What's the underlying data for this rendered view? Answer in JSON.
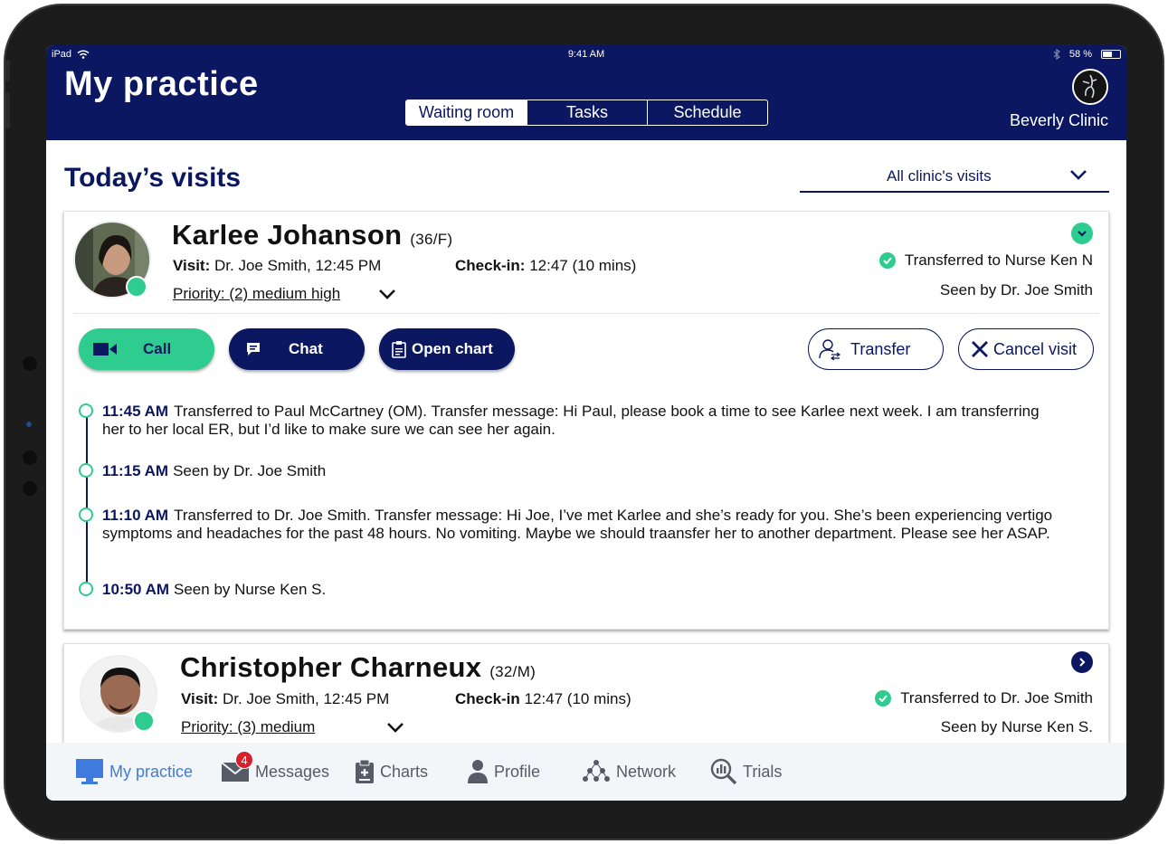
{
  "status_bar": {
    "device": "iPad",
    "time": "9:41 AM",
    "battery": "58 %"
  },
  "header": {
    "title": "My practice",
    "tabs": [
      "Waiting room",
      "Tasks",
      "Schedule"
    ],
    "clinic": "Beverly Clinic"
  },
  "main": {
    "title": "Today’s visits",
    "filter": "All clinic's visits"
  },
  "visits": [
    {
      "name": "Karlee Johanson",
      "age_sex": "(36/F)",
      "visit_label": "Visit:",
      "visit_value": "Dr. Joe Smith, 12:45 PM",
      "checkin_label": "Check-in:",
      "checkin_value": "12:47 (10 mins)",
      "priority": "Priority: (2) medium high",
      "status": "Transferred to Nurse Ken N",
      "seen": "Seen by Dr. Joe Smith",
      "actions": {
        "call": "Call",
        "chat": "Chat",
        "open_chart": "Open chart",
        "transfer": "Transfer",
        "cancel": "Cancel visit"
      },
      "timeline": [
        {
          "time": "11:45 AM",
          "text": "Transferred to Paul McCartney (OM). Transfer message: Hi Paul, please book a time to see Karlee next week. I am transferring her to her local ER, but I’d like to make sure we can see her again."
        },
        {
          "time": "11:15 AM",
          "text": "Seen by Dr. Joe Smith"
        },
        {
          "time": "11:10 AM",
          "text": "Transferred to Dr. Joe Smith. Transfer message: Hi Joe, I’ve met Karlee and she’s ready for you. She’s been experiencing vertigo symptoms and headaches for the past  48 hours. No vomiting. Maybe we should traansfer her to another department. Please see her ASAP."
        },
        {
          "time": "10:50 AM",
          "text": "Seen by Nurse Ken S."
        }
      ]
    },
    {
      "name": "Christopher Charneux",
      "age_sex": "(32/M)",
      "visit_label": "Visit:",
      "visit_value": "Dr. Joe Smith, 12:45 PM",
      "checkin_label": "Check-in",
      "checkin_value": "12:47 (10 mins)",
      "priority": "Priority: (3) medium",
      "status": "Transferred to Dr. Joe Smith",
      "seen": "Seen by Nurse Ken S."
    }
  ],
  "tabbar": {
    "items": [
      "My practice",
      "Messages",
      "Charts",
      "Profile",
      "Network",
      "Trials"
    ],
    "messages_badge": "4"
  },
  "colors": {
    "navy": "#0b1760",
    "green": "#2ecc8f",
    "active_tab": "#3f7bdc",
    "badge": "#d6202a"
  },
  "icons": [
    "wifi-icon",
    "bluetooth-icon",
    "battery-icon",
    "chevron-down-icon",
    "check-icon",
    "video-camera-icon",
    "chat-bubble-icon",
    "clipboard-icon",
    "user-transfer-icon",
    "close-icon",
    "chevron-right-icon",
    "monitor-icon",
    "mail-icon",
    "charts-icon",
    "person-icon",
    "network-icon",
    "search-chart-icon"
  ]
}
